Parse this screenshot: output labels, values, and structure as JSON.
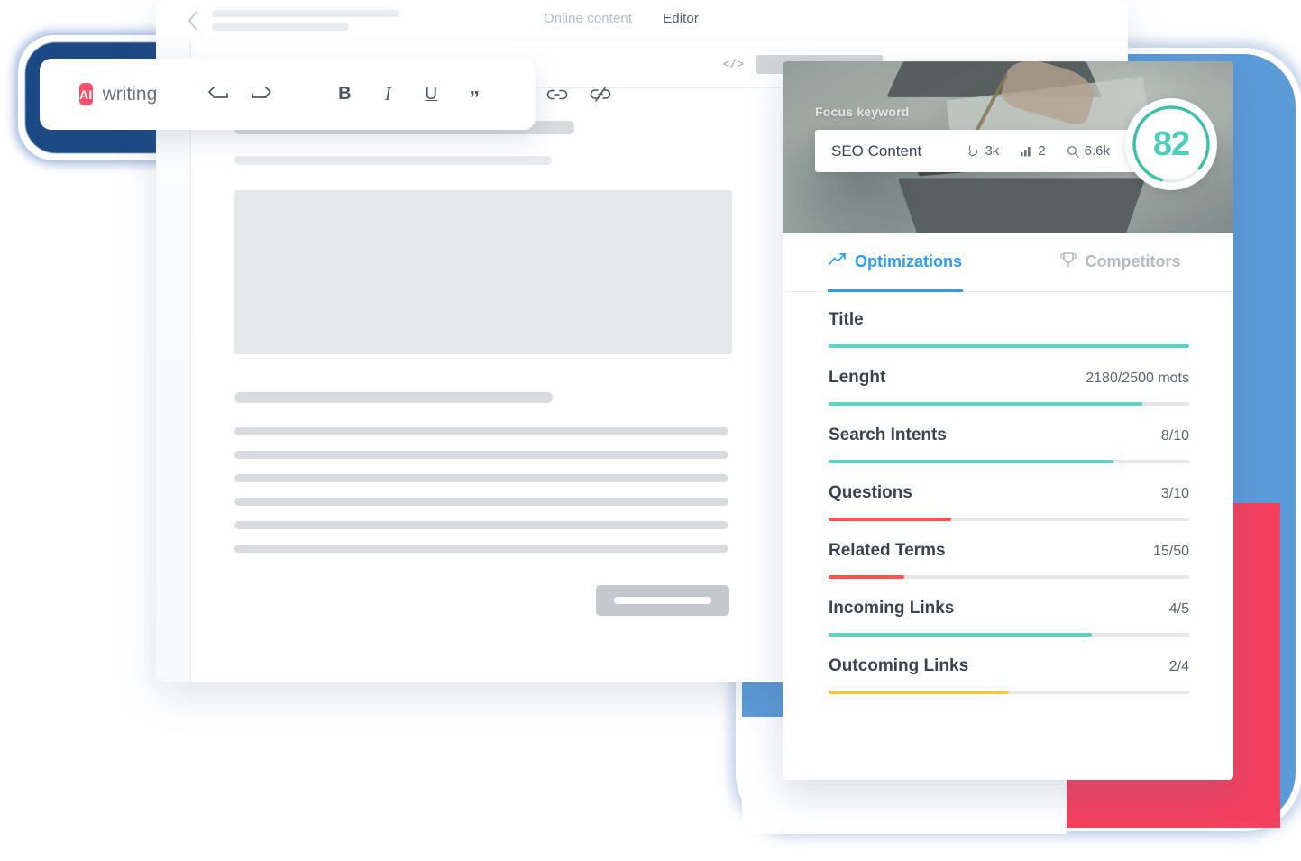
{
  "editor": {
    "header": {
      "back_icon": "chevron-left-icon",
      "tabs": [
        {
          "label": "Online content",
          "active": false
        },
        {
          "label": "Editor",
          "active": true
        }
      ]
    },
    "toolbar_row": {
      "code_icon": "code-icon"
    }
  },
  "ai_toolbar": {
    "badge": "AI",
    "title": "writing",
    "buttons": [
      {
        "name": "undo-button",
        "glyph": "↩"
      },
      {
        "name": "redo-button",
        "glyph": "↪"
      },
      {
        "name": "bold-button",
        "glyph": "B"
      },
      {
        "name": "italic-button",
        "glyph": "I"
      },
      {
        "name": "underline-button",
        "glyph": "U"
      },
      {
        "name": "blockquote-button",
        "glyph": "”"
      },
      {
        "name": "link-button",
        "glyph": "link-icon"
      },
      {
        "name": "unlink-button",
        "glyph": "unlink-icon"
      }
    ]
  },
  "seo_panel": {
    "focus_keyword_label": "Focus keyword",
    "keyword": "SEO Content",
    "metrics_inline": [
      {
        "icon": "click-icon",
        "value": "3k"
      },
      {
        "icon": "bar-chart-icon",
        "value": "2"
      },
      {
        "icon": "search-icon",
        "value": "6.6k"
      }
    ],
    "score": "82",
    "score_percent": 82,
    "tabs": [
      {
        "label": "Optimizations",
        "icon": "trend-up-icon",
        "active": true
      },
      {
        "label": "Competitors",
        "icon": "trophy-icon",
        "active": false
      }
    ],
    "optimizations": [
      {
        "label": "Title",
        "value": "",
        "percent": 100,
        "color": "#5ecfc0"
      },
      {
        "label": "Lenght",
        "value": "2180/2500 mots",
        "percent": 87,
        "color": "#5ecfc0"
      },
      {
        "label": "Search Intents",
        "value": "8/10",
        "percent": 79,
        "color": "#5ecfc0"
      },
      {
        "label": "Questions",
        "value": "3/10",
        "percent": 34,
        "color": "#f4554f"
      },
      {
        "label": "Related Terms",
        "value": "15/50",
        "percent": 21,
        "color": "#f4554f"
      },
      {
        "label": "Incoming Links",
        "value": "4/5",
        "percent": 73,
        "color": "#5ecfc0"
      },
      {
        "label": "Outcoming Links",
        "value": "2/4",
        "percent": 50,
        "color": "#f5c542"
      }
    ]
  },
  "colors": {
    "accent_blue": "#2f9bef",
    "teal": "#5ecfc0",
    "red": "#f4554f",
    "yellow": "#f5c542",
    "badge_red": "#f4506a",
    "frame_blue": "#5b9bd8",
    "frame_navy": "#1b4a86",
    "arrow_red": "#f4405f"
  }
}
